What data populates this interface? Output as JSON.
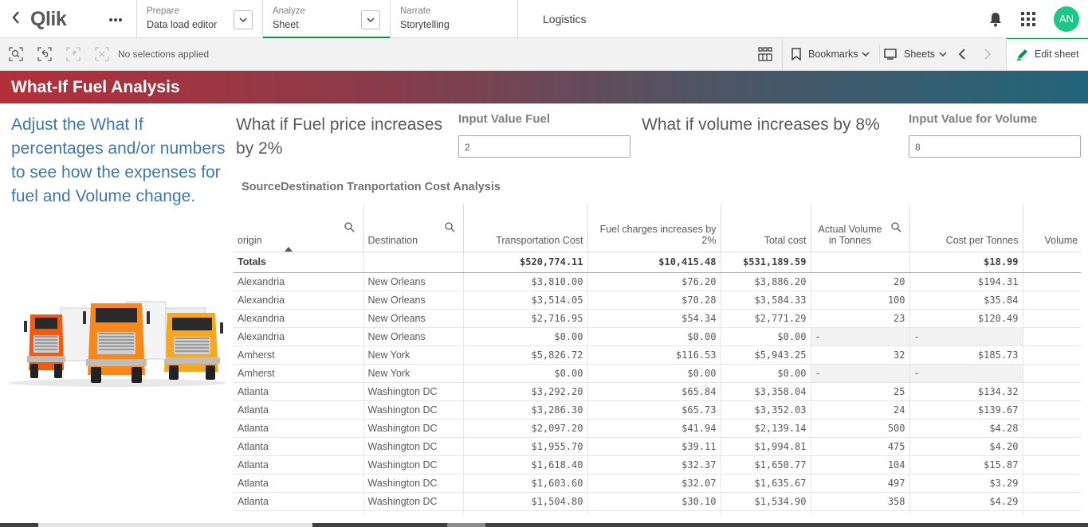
{
  "topbar": {
    "logo": "Qlik",
    "nav": [
      {
        "small": "Prepare",
        "big": "Data load editor"
      },
      {
        "small": "Analyze",
        "big": "Sheet"
      },
      {
        "small": "Narrate",
        "big": "Storytelling"
      }
    ],
    "app_title": "Logistics",
    "avatar_initials": "AN"
  },
  "toolbar": {
    "selection_status": "No selections applied",
    "bookmarks_label": "Bookmarks",
    "sheets_label": "Sheets",
    "edit_sheet_label": "Edit sheet"
  },
  "sheet": {
    "title": "What-If Fuel Analysis",
    "description": "Adjust the What If percentages and/or numbers to see how the expenses for fuel and Volume change.",
    "fuel_question": "What if Fuel price increases by 2%",
    "fuel_input_label": "Input Value Fuel",
    "fuel_input_value": "2",
    "volume_question": "What if volume increases by 8%",
    "volume_input_label": "Input Value for Volume",
    "volume_input_value": "8",
    "table_title": "SourceDestination Tranportation Cost Analysis"
  },
  "table": {
    "headers": [
      "origin",
      "Destination",
      "Transportation Cost",
      "Fuel charges increases by 2%",
      "Total cost",
      "Actual Volume in Tonnes",
      "Cost per Tonnes",
      "Volume"
    ],
    "totals": [
      "Totals",
      "",
      "$520,774.11",
      "$10,415.48",
      "$531,189.59",
      "",
      "$18.99",
      ""
    ],
    "rows": [
      [
        "Alexandria",
        "New Orleans",
        "$3,810.00",
        "$76.20",
        "$3,886.20",
        "20",
        "$194.31",
        ""
      ],
      [
        "Alexandria",
        "New Orleans",
        "$3,514.05",
        "$70.28",
        "$3,584.33",
        "100",
        "$35.84",
        ""
      ],
      [
        "Alexandria",
        "New Orleans",
        "$2,716.95",
        "$54.34",
        "$2,771.29",
        "23",
        "$120.49",
        ""
      ],
      [
        "Alexandria",
        "New Orleans",
        "$0.00",
        "$0.00",
        "$0.00",
        "-",
        "-",
        ""
      ],
      [
        "Amherst",
        "New York",
        "$5,826.72",
        "$116.53",
        "$5,943.25",
        "32",
        "$185.73",
        ""
      ],
      [
        "Amherst",
        "New York",
        "$0.00",
        "$0.00",
        "$0.00",
        "-",
        "-",
        ""
      ],
      [
        "Atlanta",
        "Washington DC",
        "$3,292.20",
        "$65.84",
        "$3,358.04",
        "25",
        "$134.32",
        ""
      ],
      [
        "Atlanta",
        "Washington DC",
        "$3,286.30",
        "$65.73",
        "$3,352.03",
        "24",
        "$139.67",
        ""
      ],
      [
        "Atlanta",
        "Washington DC",
        "$2,097.20",
        "$41.94",
        "$2,139.14",
        "500",
        "$4.28",
        ""
      ],
      [
        "Atlanta",
        "Washington DC",
        "$1,955.70",
        "$39.11",
        "$1,994.81",
        "475",
        "$4.20",
        ""
      ],
      [
        "Atlanta",
        "Washington DC",
        "$1,618.40",
        "$32.37",
        "$1,650.77",
        "104",
        "$15.87",
        ""
      ],
      [
        "Atlanta",
        "Washington DC",
        "$1,603.60",
        "$32.07",
        "$1,635.67",
        "497",
        "$3.29",
        ""
      ],
      [
        "Atlanta",
        "Washington DC",
        "$1,504.80",
        "$30.10",
        "$1,534.90",
        "358",
        "$4.29",
        ""
      ],
      [
        "",
        "",
        "",
        "",
        "",
        "",
        "",
        ""
      ]
    ]
  },
  "colors": {
    "accent": "#009845",
    "title_gradient_start": "#b3303a",
    "title_gradient_end": "#21657a",
    "description_text": "#4177a8",
    "avatar": "#1ec788"
  }
}
